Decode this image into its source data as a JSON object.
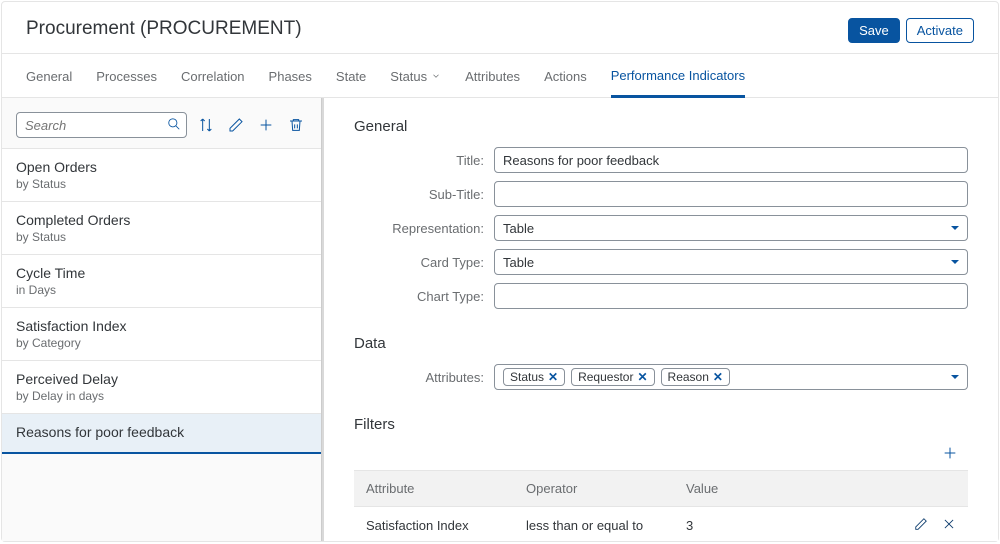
{
  "header": {
    "title": "Procurement (PROCUREMENT)",
    "save_label": "Save",
    "activate_label": "Activate"
  },
  "tabs": [
    "General",
    "Processes",
    "Correlation",
    "Phases",
    "State",
    "Status",
    "Attributes",
    "Actions",
    "Performance Indicators"
  ],
  "active_tab": "Performance Indicators",
  "dropdown_tab": "Status",
  "sidebar": {
    "search_placeholder": "Search",
    "items": [
      {
        "title": "Open Orders",
        "sub": "by Status"
      },
      {
        "title": "Completed Orders",
        "sub": "by Status"
      },
      {
        "title": "Cycle Time",
        "sub": "in Days"
      },
      {
        "title": "Satisfaction Index",
        "sub": "by Category"
      },
      {
        "title": "Perceived Delay",
        "sub": "by Delay in days"
      },
      {
        "title": "Reasons for poor feedback",
        "sub": ""
      }
    ],
    "selected_index": 5
  },
  "form": {
    "section_general": "General",
    "section_data": "Data",
    "section_filters": "Filters",
    "labels": {
      "title": "Title:",
      "subtitle": "Sub-Title:",
      "representation": "Representation:",
      "card_type": "Card Type:",
      "chart_type": "Chart Type:",
      "attributes": "Attributes:"
    },
    "values": {
      "title": "Reasons for poor feedback",
      "subtitle": "",
      "representation": "Table",
      "card_type": "Table",
      "chart_type": ""
    },
    "attribute_tokens": [
      "Status",
      "Requestor",
      "Reason"
    ]
  },
  "filters": {
    "headers": {
      "attribute": "Attribute",
      "operator": "Operator",
      "value": "Value"
    },
    "rows": [
      {
        "attribute": "Satisfaction Index",
        "operator": "less than or equal to",
        "value": "3"
      }
    ]
  }
}
